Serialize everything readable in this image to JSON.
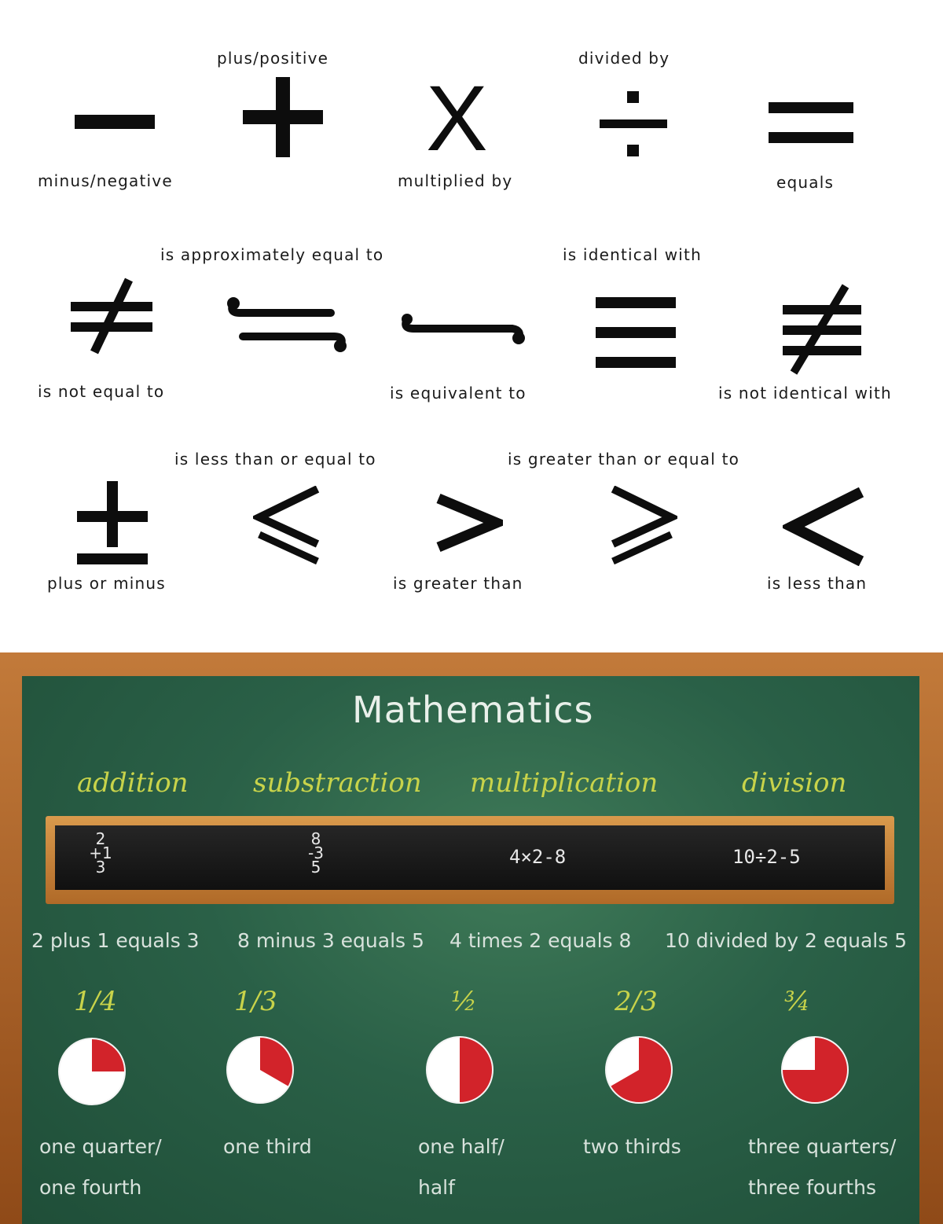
{
  "symbols": {
    "row1": {
      "minus": "minus/negative",
      "plus": "plus/positive",
      "times": "multiplied by",
      "divide": "divided by",
      "equals": "equals"
    },
    "row2": {
      "not_equal": "is not equal to",
      "approx": "is approximately equal to",
      "equivalent": "is equivalent to",
      "identical": "is identical with",
      "not_identical": "is not identical with"
    },
    "row3": {
      "plus_minus": "plus or minus",
      "less_equal": "is less than or equal to",
      "greater": "is greater than",
      "greater_equal": "is greater than or equal to",
      "less": "is less than"
    },
    "times_glyph": "X"
  },
  "board": {
    "title": "Mathematics",
    "operations": [
      "addition",
      "substraction",
      "multiplication",
      "division"
    ],
    "slate": {
      "addition": {
        "top": "2",
        "mid": "+1",
        "bottom": "3"
      },
      "subtraction": {
        "top": "8",
        "mid": "-3",
        "bottom": "5"
      },
      "multiplication": "4×2-8",
      "division": "10÷2-5"
    },
    "sentences": [
      "2 plus 1 equals 3",
      "8 minus 3 equals 5",
      "4 times 2 equals 8",
      "10 divided by 2 equals 5"
    ],
    "fractions": [
      {
        "label": "1/4",
        "value": 0.25,
        "line1": "one quarter/",
        "line2": "one fourth"
      },
      {
        "label": "1/3",
        "value": 0.3333,
        "line1": "one third",
        "line2": ""
      },
      {
        "label": "½",
        "value": 0.5,
        "line1": "one half/",
        "line2": "half"
      },
      {
        "label": "2/3",
        "value": 0.6667,
        "line1": "two thirds",
        "line2": ""
      },
      {
        "label": "¾",
        "value": 0.75,
        "line1": "three quarters/",
        "line2": "three fourths"
      }
    ],
    "colors": {
      "chalkboard": "#2a6047",
      "frame": "#a55a22",
      "pie_fill": "#d2232a",
      "pie_base": "#ffffff",
      "chalk_yellow": "#c8d34a"
    }
  }
}
